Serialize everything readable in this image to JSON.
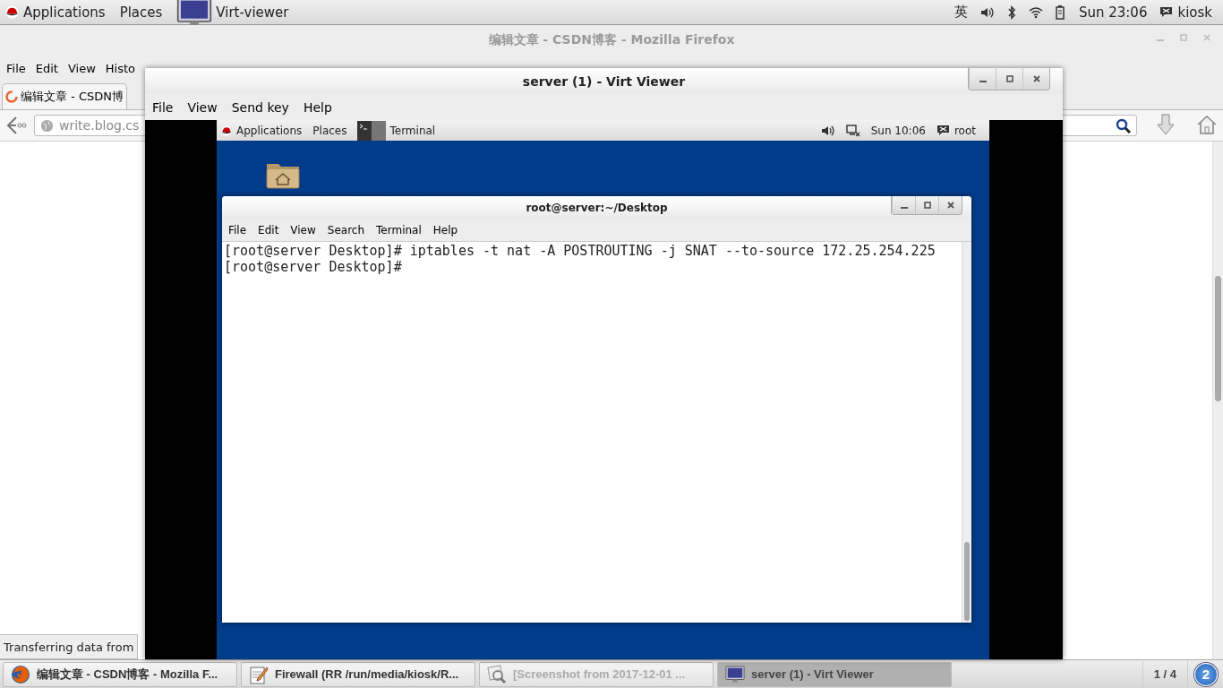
{
  "top_panel": {
    "applications": "Applications",
    "places": "Places",
    "active_window": "Virt-viewer",
    "input_method": "英",
    "clock": "Sun 23:06",
    "user": "kiosk"
  },
  "firefox": {
    "title": "编辑文章 - CSDN博客 - Mozilla Firefox",
    "menu": [
      "File",
      "Edit",
      "View",
      "Histo"
    ],
    "tabs": [
      {
        "label": "编辑文章 - CSDN博",
        "selected": true
      }
    ],
    "url": "write.blog.cs",
    "status": "Transferring data from"
  },
  "virt_viewer": {
    "title": "server (1) - Virt Viewer",
    "menu": [
      "File",
      "View",
      "Send key",
      "Help"
    ],
    "guest": {
      "panel": {
        "applications": "Applications",
        "places": "Places",
        "active_window": "Terminal",
        "clock": "Sun 10:06",
        "user": "root"
      },
      "terminal": {
        "title": "root@server:~/Desktop",
        "menu": [
          "File",
          "Edit",
          "View",
          "Search",
          "Terminal",
          "Help"
        ],
        "lines": [
          "[root@server Desktop]# iptables -t nat -A POSTROUTING -j SNAT --to-source 172.25.254.225",
          "[root@server Desktop]#"
        ]
      }
    }
  },
  "taskbar": {
    "items": [
      {
        "kind": "firefox",
        "label": "编辑文章 - CSDN博客 - Mozilla F...",
        "selected": false,
        "minimized": false
      },
      {
        "kind": "editor",
        "label": "Firewall (RR /run/media/kiosk/R...",
        "selected": false,
        "minimized": false
      },
      {
        "kind": "viewer",
        "label": "[Screenshot from 2017-12-01 ...",
        "selected": false,
        "minimized": true
      },
      {
        "kind": "monitor",
        "label": "server (1) - Virt Viewer",
        "selected": true,
        "minimized": false
      }
    ],
    "workspace": "1 / 4",
    "notifications": "2"
  }
}
